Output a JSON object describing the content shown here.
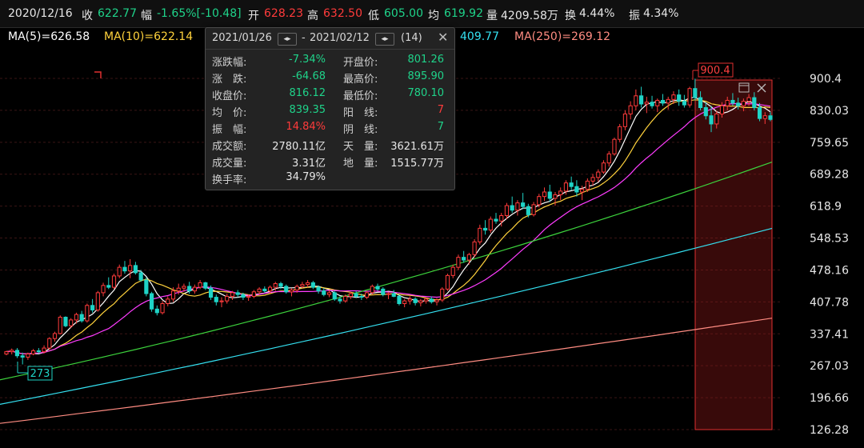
{
  "topbar": {
    "date": "2020/12/16",
    "close_label": "收",
    "close": "622.77",
    "change_label": "幅",
    "change": "-1.65%[-10.48]",
    "open_label": "开",
    "open": "628.23",
    "high_label": "高",
    "high": "632.50",
    "low_label": "低",
    "low": "605.00",
    "avg_label": "均",
    "avg": "619.92",
    "vol_label": "量",
    "vol": "4209.58万",
    "turnover_label": "换",
    "turnover": "4.44%",
    "amp_label": "振",
    "amp": "4.34%"
  },
  "ma_bar": {
    "ma5": "MA(5)=626.58",
    "ma10": "MA(10)=622.14",
    "ma120_partial": "409.77",
    "ma250": "MA(250)=269.12"
  },
  "colors": {
    "up": "#ff3b3b",
    "down": "#1fd3c6",
    "ma5": "#ffffff",
    "ma10": "#ffd23c",
    "ma20": "#ff3cff",
    "ma60": "#3cd23c",
    "ma120": "#34e0f0",
    "ma250": "#ff8c82",
    "grid": "#3a1414"
  },
  "tooltip": {
    "range_start": "2021/01/26",
    "range_sep": "-",
    "range_end": "2021/02/12",
    "count": "(14)",
    "close_icon": "close-icon",
    "rows": [
      {
        "k1": "涨跌幅:",
        "v1": "-7.34%",
        "c1": "green",
        "k2": "开盘价:",
        "v2": "801.26",
        "c2": "green"
      },
      {
        "k1": "涨　跌:",
        "v1": "-64.68",
        "c1": "green",
        "k2": "最高价:",
        "v2": "895.90",
        "c2": "green"
      },
      {
        "k1": "收盘价:",
        "v1": "816.12",
        "c1": "green",
        "k2": "最低价:",
        "v2": "780.10",
        "c2": "green"
      },
      {
        "k1": "均　价:",
        "v1": "839.35",
        "c1": "green",
        "k2": "阳　线:",
        "v2": "7",
        "c2": "red"
      },
      {
        "k1": "振　幅:",
        "v1": "14.84%",
        "c1": "red",
        "k2": "阴　线:",
        "v2": "7",
        "c2": "green"
      },
      {
        "k1": "成交额:",
        "v1": "2780.11亿",
        "c1": "white",
        "k2": "天　量:",
        "v2": "3621.61万",
        "c2": "white"
      },
      {
        "k1": "成交量:",
        "v1": "3.31亿",
        "c1": "white",
        "k2": "地　量:",
        "v2": "1515.77万",
        "c2": "white"
      },
      {
        "k1": "换手率:",
        "v1": "34.79%",
        "c1": "white",
        "k2": "",
        "v2": "",
        "c2": "white"
      }
    ]
  },
  "chart_data": {
    "type": "candlestick",
    "y_ticks": [
      "900.4",
      "830.03",
      "759.65",
      "689.28",
      "618.9",
      "548.53",
      "478.16",
      "407.78",
      "337.41",
      "267.03",
      "196.66",
      "126.28"
    ],
    "ylim": [
      126.28,
      900.4
    ],
    "high_marker": "900.4",
    "low_marker": "273",
    "selection": {
      "start": "2021/01/26",
      "end": "2021/02/12"
    },
    "ohlc": [
      [
        293,
        300,
        290,
        298
      ],
      [
        298,
        305,
        292,
        301
      ],
      [
        301,
        306,
        284,
        289
      ],
      [
        289,
        296,
        270,
        286
      ],
      [
        286,
        296,
        280,
        293
      ],
      [
        293,
        304,
        290,
        300
      ],
      [
        300,
        306,
        294,
        298
      ],
      [
        298,
        312,
        294,
        306
      ],
      [
        306,
        330,
        302,
        327
      ],
      [
        327,
        342,
        320,
        338
      ],
      [
        338,
        378,
        336,
        374
      ],
      [
        374,
        376,
        352,
        355
      ],
      [
        355,
        372,
        350,
        368
      ],
      [
        368,
        384,
        360,
        380
      ],
      [
        380,
        388,
        362,
        366
      ],
      [
        366,
        404,
        362,
        400
      ],
      [
        400,
        414,
        384,
        390
      ],
      [
        390,
        432,
        386,
        428
      ],
      [
        428,
        450,
        420,
        444
      ],
      [
        444,
        462,
        436,
        440
      ],
      [
        440,
        470,
        436,
        465
      ],
      [
        465,
        490,
        460,
        484
      ],
      [
        484,
        498,
        470,
        476
      ],
      [
        476,
        502,
        460,
        488
      ],
      [
        488,
        496,
        468,
        472
      ],
      [
        472,
        478,
        452,
        456
      ],
      [
        456,
        462,
        420,
        426
      ],
      [
        426,
        430,
        386,
        392
      ],
      [
        392,
        400,
        378,
        384
      ],
      [
        384,
        410,
        380,
        404
      ],
      [
        404,
        420,
        398,
        414
      ],
      [
        414,
        440,
        408,
        432
      ],
      [
        432,
        448,
        424,
        438
      ],
      [
        438,
        448,
        430,
        442
      ],
      [
        442,
        452,
        426,
        432
      ],
      [
        432,
        446,
        426,
        440
      ],
      [
        440,
        456,
        436,
        450
      ],
      [
        450,
        452,
        434,
        438
      ],
      [
        438,
        444,
        412,
        418
      ],
      [
        418,
        424,
        400,
        408
      ],
      [
        408,
        418,
        396,
        410
      ],
      [
        410,
        426,
        404,
        420
      ],
      [
        420,
        432,
        412,
        428
      ],
      [
        428,
        434,
        418,
        424
      ],
      [
        424,
        428,
        412,
        418
      ],
      [
        418,
        424,
        410,
        420
      ],
      [
        420,
        434,
        416,
        430
      ],
      [
        430,
        440,
        424,
        436
      ],
      [
        436,
        442,
        428,
        432
      ],
      [
        432,
        444,
        426,
        440
      ],
      [
        440,
        452,
        432,
        448
      ],
      [
        448,
        452,
        436,
        442
      ],
      [
        442,
        446,
        426,
        430
      ],
      [
        430,
        438,
        420,
        434
      ],
      [
        434,
        446,
        428,
        442
      ],
      [
        442,
        452,
        438,
        446
      ],
      [
        446,
        456,
        440,
        450
      ],
      [
        450,
        454,
        436,
        440
      ],
      [
        440,
        444,
        426,
        432
      ],
      [
        432,
        438,
        420,
        424
      ],
      [
        424,
        434,
        418,
        428
      ],
      [
        428,
        432,
        410,
        414
      ],
      [
        414,
        420,
        404,
        410
      ],
      [
        410,
        424,
        406,
        420
      ],
      [
        420,
        430,
        414,
        426
      ],
      [
        426,
        432,
        416,
        420
      ],
      [
        420,
        426,
        412,
        418
      ],
      [
        418,
        432,
        414,
        428
      ],
      [
        428,
        446,
        424,
        442
      ],
      [
        442,
        448,
        432,
        436
      ],
      [
        436,
        440,
        420,
        424
      ],
      [
        424,
        430,
        414,
        426
      ],
      [
        426,
        434,
        418,
        420
      ],
      [
        420,
        424,
        400,
        404
      ],
      [
        404,
        414,
        396,
        410
      ],
      [
        410,
        420,
        402,
        414
      ],
      [
        414,
        418,
        400,
        406
      ],
      [
        406,
        414,
        398,
        410
      ],
      [
        410,
        418,
        404,
        414
      ],
      [
        414,
        420,
        404,
        408
      ],
      [
        408,
        416,
        400,
        412
      ],
      [
        412,
        440,
        408,
        436
      ],
      [
        436,
        470,
        432,
        466
      ],
      [
        466,
        490,
        460,
        484
      ],
      [
        484,
        512,
        478,
        506
      ],
      [
        506,
        520,
        494,
        500
      ],
      [
        500,
        516,
        490,
        512
      ],
      [
        512,
        546,
        506,
        540
      ],
      [
        540,
        578,
        534,
        570
      ],
      [
        570,
        588,
        556,
        566
      ],
      [
        566,
        596,
        560,
        590
      ],
      [
        590,
        604,
        580,
        586
      ],
      [
        586,
        604,
        574,
        598
      ],
      [
        598,
        626,
        590,
        620
      ],
      [
        620,
        640,
        604,
        610
      ],
      [
        610,
        632,
        598,
        626
      ],
      [
        626,
        648,
        612,
        618
      ],
      [
        618,
        624,
        594,
        600
      ],
      [
        600,
        628,
        596,
        622
      ],
      [
        622,
        646,
        616,
        640
      ],
      [
        640,
        660,
        630,
        650
      ],
      [
        650,
        666,
        628,
        636
      ],
      [
        636,
        650,
        620,
        644
      ],
      [
        644,
        660,
        632,
        652
      ],
      [
        652,
        676,
        644,
        670
      ],
      [
        670,
        684,
        654,
        662
      ],
      [
        662,
        676,
        640,
        650
      ],
      [
        650,
        664,
        632,
        656
      ],
      [
        656,
        680,
        650,
        674
      ],
      [
        674,
        690,
        664,
        682
      ],
      [
        682,
        700,
        672,
        694
      ],
      [
        694,
        720,
        690,
        714
      ],
      [
        714,
        740,
        706,
        734
      ],
      [
        734,
        770,
        730,
        766
      ],
      [
        766,
        800,
        760,
        794
      ],
      [
        794,
        830,
        786,
        822
      ],
      [
        822,
        850,
        810,
        840
      ],
      [
        840,
        876,
        830,
        862
      ],
      [
        862,
        882,
        836,
        844
      ],
      [
        844,
        860,
        824,
        848
      ],
      [
        848,
        862,
        834,
        840
      ],
      [
        840,
        856,
        826,
        852
      ],
      [
        852,
        866,
        840,
        846
      ],
      [
        846,
        860,
        832,
        854
      ],
      [
        854,
        872,
        844,
        864
      ],
      [
        864,
        876,
        840,
        850
      ],
      [
        850,
        864,
        836,
        842
      ],
      [
        842,
        882,
        836,
        878
      ],
      [
        878,
        900,
        852,
        858
      ],
      [
        858,
        872,
        830,
        836
      ],
      [
        836,
        848,
        810,
        818
      ],
      [
        818,
        840,
        782,
        800
      ],
      [
        800,
        828,
        790,
        822
      ],
      [
        822,
        848,
        814,
        840
      ],
      [
        840,
        860,
        830,
        852
      ],
      [
        852,
        868,
        840,
        846
      ],
      [
        846,
        858,
        832,
        840
      ],
      [
        840,
        856,
        828,
        850
      ],
      [
        850,
        866,
        840,
        858
      ],
      [
        858,
        870,
        830,
        836
      ],
      [
        836,
        846,
        806,
        812
      ],
      [
        812,
        826,
        800,
        818
      ],
      [
        818,
        826,
        806,
        810
      ]
    ],
    "series": [
      {
        "name": "MA(5)",
        "values": []
      },
      {
        "name": "MA(10)",
        "values": []
      },
      {
        "name": "",
        "values": []
      },
      {
        "name": "",
        "values": []
      },
      {
        "name": "",
        "values": []
      },
      {
        "name": "MA(250)",
        "values": []
      }
    ]
  }
}
